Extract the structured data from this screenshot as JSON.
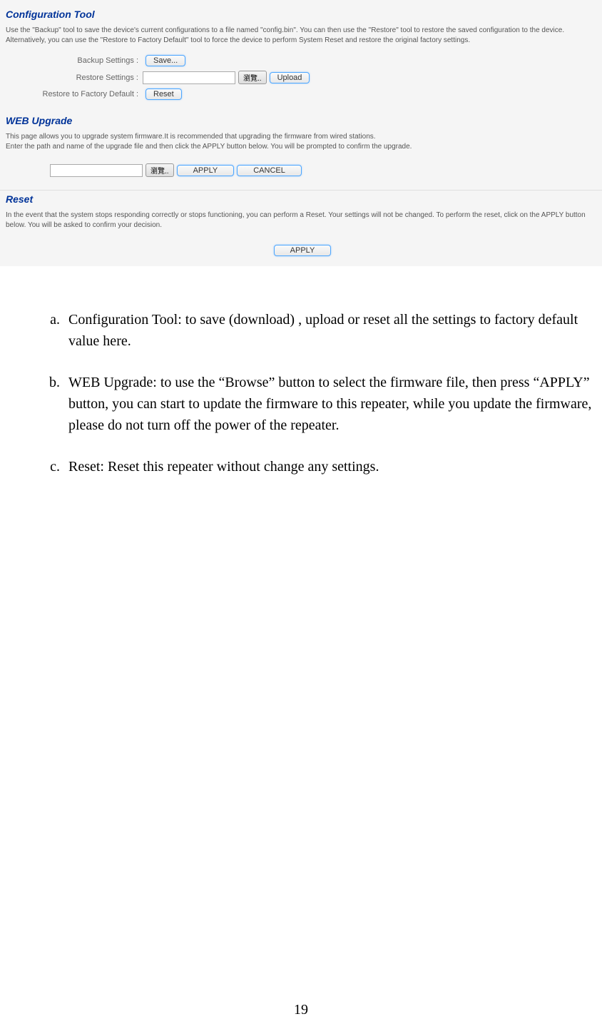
{
  "config_tool": {
    "title": "Configuration Tool",
    "desc": "Use the \"Backup\" tool to save the device's current configurations to a file named \"config.bin\". You can then use the \"Restore\" tool to restore the saved configuration to the device. Alternatively, you can use the \"Restore to Factory Default\" tool to force the device to perform System Reset and restore the original factory settings.",
    "backup_label": "Backup Settings :",
    "save_btn": "Save...",
    "restore_label": "Restore Settings :",
    "browse_btn": "瀏覽..",
    "upload_btn": "Upload",
    "factory_label": "Restore to Factory Default :",
    "reset_btn": "Reset"
  },
  "web_upgrade": {
    "title": "WEB Upgrade",
    "desc": "This page allows you to upgrade system firmware.It is recommended that upgrading the firmware from wired stations.\nEnter the path and name of the upgrade file and then click the APPLY button below. You will be prompted to confirm the upgrade.",
    "browse_btn": "瀏覽..",
    "apply_btn": "APPLY",
    "cancel_btn": "CANCEL"
  },
  "reset_section": {
    "title": "Reset",
    "desc": "In the event that the system stops responding correctly or stops functioning, you can perform a Reset. Your settings will not be changed. To perform the reset, click on the APPLY button below. You will be asked to confirm your decision.",
    "apply_btn": "APPLY"
  },
  "doc": {
    "items": [
      {
        "marker": "a.",
        "text": "Configuration Tool: to save (download) , upload or reset all the settings to factory default value here."
      },
      {
        "marker": "b.",
        "text": "WEB Upgrade: to use the “Browse” button to select the firmware file, then press “APPLY” button, you can start to update the firmware to this repeater, while you update the firmware, please do not turn off the power of the repeater."
      },
      {
        "marker": "c.",
        "text": "Reset: Reset this repeater without change any settings."
      }
    ],
    "page_number": "19"
  }
}
